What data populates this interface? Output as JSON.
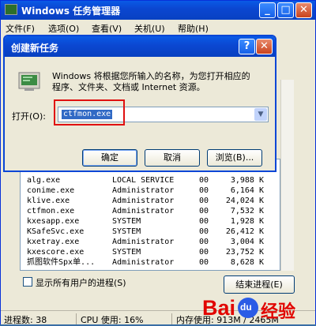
{
  "window": {
    "title": "Windows 任务管理器",
    "minimize_glyph": "_",
    "maximize_glyph": "□",
    "close_glyph": "✕"
  },
  "menu": [
    "文件(F)",
    "选项(O)",
    "查看(V)",
    "关机(U)",
    "帮助(H)"
  ],
  "dialog": {
    "title": "创建新任务",
    "help_glyph": "?",
    "close_glyph": "✕",
    "description_line1": "Windows 将根据您所输入的名称，为您打开相应的",
    "description_line2": "程序、文件夹、文档或 Internet 资源。",
    "open_label": "打开(O):",
    "open_value": "ctfmon.exe",
    "ok": "确定",
    "cancel": "取消",
    "browse": "浏览(B)..."
  },
  "processes": [
    {
      "name": "alg.exe",
      "user": "LOCAL SERVICE",
      "cpu": "00",
      "mem": "3,988 K"
    },
    {
      "name": "conime.exe",
      "user": "Administrator",
      "cpu": "00",
      "mem": "6,164 K"
    },
    {
      "name": "klive.exe",
      "user": "Administrator",
      "cpu": "00",
      "mem": "24,024 K"
    },
    {
      "name": "ctfmon.exe",
      "user": "Administrator",
      "cpu": "00",
      "mem": "7,532 K"
    },
    {
      "name": "kxesapp.exe",
      "user": "SYSTEM",
      "cpu": "00",
      "mem": "1,928 K"
    },
    {
      "name": "KSafeSvc.exe",
      "user": "SYSTEM",
      "cpu": "00",
      "mem": "26,412 K"
    },
    {
      "name": "kxetray.exe",
      "user": "Administrator",
      "cpu": "00",
      "mem": "3,004 K"
    },
    {
      "name": "kxescore.exe",
      "user": "SYSTEM",
      "cpu": "00",
      "mem": "23,752 K"
    },
    {
      "name": "抓图软件Spx单...",
      "user": "Administrator",
      "cpu": "00",
      "mem": "8,628 K"
    }
  ],
  "show_all_users": "显示所有用户的进程(S)",
  "end_process": "结束进程(E)",
  "status": {
    "processes": "进程数: 38",
    "cpu": "CPU 使用: 16%",
    "memory": "内存使用: 913M / 2465M"
  },
  "watermark": {
    "bai": "Bai",
    "du": "du",
    "jingyan": "经验"
  },
  "colors": {
    "titlebar": "#0b47d1",
    "highlight_box": "#e01010",
    "selection": "#316ac5",
    "watermark_red": "#e10601",
    "watermark_blue": "#2b5ce6"
  },
  "icons": [
    "app-icon",
    "dialog-run-icon",
    "dropdown-arrow-icon"
  ]
}
